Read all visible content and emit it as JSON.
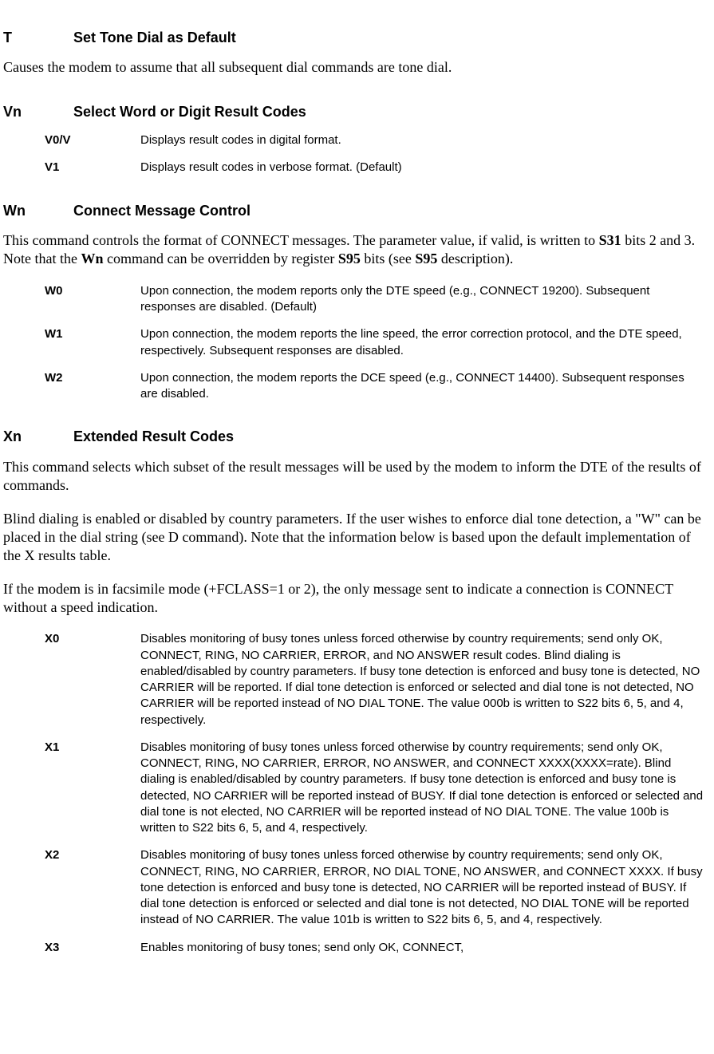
{
  "sections": [
    {
      "code": "T",
      "title": "Set Tone Dial as Default",
      "paragraphs": [
        "Causes the modem to assume that all subsequent dial commands are tone dial."
      ],
      "defs": []
    },
    {
      "code": "Vn",
      "title": "Select Word or Digit Result Codes",
      "paragraphs": [],
      "defs": [
        {
          "key": "V0/V",
          "text": "Displays result codes in digital format."
        },
        {
          "key": "V1",
          "text": "Displays result codes in verbose format. (Default)"
        }
      ]
    },
    {
      "code": "Wn",
      "title": "Connect Message Control",
      "paragraphs": [
        "This command controls the format of CONNECT messages. The parameter value, if valid, is written to <b>S31</b> bits 2 and 3. Note that the <b>Wn</b> command can be overridden by register <b>S95</b> bits (see <b>S95</b> description)."
      ],
      "defs": [
        {
          "key": "W0",
          "text": "Upon connection, the modem reports only the DTE speed (e.g., CONNECT 19200). Subsequent responses are disabled. (Default)"
        },
        {
          "key": "W1",
          "text": "Upon connection, the modem reports the line speed, the error correction protocol, and the DTE speed, respectively. Subsequent responses are disabled."
        },
        {
          "key": "W2",
          "text": "Upon connection, the modem reports the DCE speed (e.g., CONNECT 14400). Subsequent responses are disabled."
        }
      ]
    },
    {
      "code": "Xn",
      "title": "Extended Result Codes",
      "paragraphs": [
        "This command selects which subset of the result messages will be used by the modem to inform the DTE of the results of commands.",
        "Blind dialing is enabled or disabled by country parameters. If the user wishes to enforce dial tone detection, a \"W\" can be placed in the dial string (see D command). Note that the information below is based upon the default implementation of the X results table.",
        "If the modem is in facsimile mode (+FCLASS=1 or 2), the only message sent to indicate a connection is CONNECT without a speed indication."
      ],
      "defs": [
        {
          "key": "X0",
          "text": "Disables monitoring of busy tones unless forced otherwise by country requirements; send only OK, CONNECT, RING, NO CARRIER, ERROR, and NO ANSWER result codes. Blind dialing is enabled/disabled by country parameters. If busy tone detection is enforced and busy tone is detected, NO CARRIER will be reported. If dial tone detection is enforced or selected and dial tone is not detected, NO CARRIER will be reported instead of NO DIAL TONE. The value 000b is written to S22 bits 6, 5, and 4, respectively."
        },
        {
          "key": "X1",
          "text": "Disables monitoring of busy tones unless forced otherwise by country requirements; send only OK, CONNECT, RING, NO CARRIER, ERROR, NO ANSWER, and CONNECT XXXX(XXXX=rate). Blind dialing is enabled/disabled by country parameters. If busy tone detection is enforced and busy tone is detected, NO CARRIER will be reported instead of BUSY. If dial tone detection is enforced or selected and dial tone is not elected, NO CARRIER will be reported instead of NO DIAL TONE. The value 100b is written to S22 bits 6, 5, and 4, respectively."
        },
        {
          "key": "X2",
          "text": "Disables monitoring of busy tones unless forced otherwise by country requirements; send only OK, CONNECT, RING, NO CARRIER, ERROR, NO DIAL TONE, NO ANSWER, and CONNECT XXXX. If busy tone detection is enforced and busy tone is detected, NO CARRIER will be reported instead of BUSY. If dial tone detection is enforced or selected and dial tone is not detected, NO DIAL TONE will be reported instead of NO CARRIER. The value 101b is written to S22 bits 6, 5, and 4, respectively."
        },
        {
          "key": "X3",
          "text": "Enables monitoring of busy tones; send only OK, CONNECT,"
        }
      ]
    }
  ]
}
